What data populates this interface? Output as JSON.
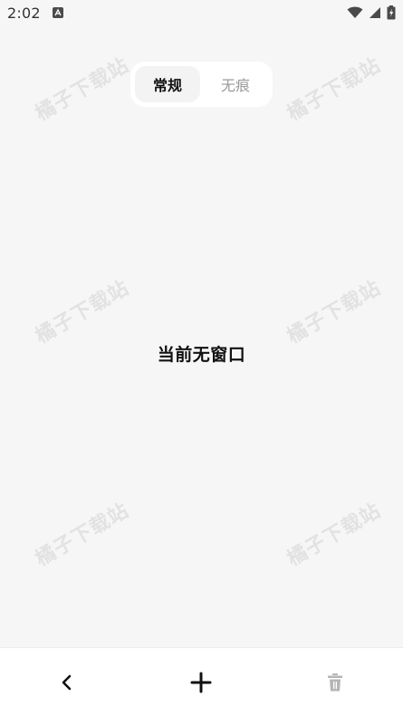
{
  "status_bar": {
    "time": "2:02",
    "icons": [
      "app-notification-icon",
      "wifi-icon",
      "cellular-signal-icon",
      "battery-charging-icon"
    ]
  },
  "tabs": {
    "items": [
      {
        "label": "常规",
        "selected": true
      },
      {
        "label": "无痕",
        "selected": false
      }
    ]
  },
  "main": {
    "empty_message": "当前无窗口"
  },
  "watermark": {
    "text": "橘子下载站"
  },
  "toolbar": {
    "back_icon": "chevron-left-icon",
    "add_icon": "plus-icon",
    "delete_icon": "trash-icon",
    "delete_enabled": false
  },
  "colors": {
    "background": "#f6f6f6",
    "surface": "#ffffff",
    "text_primary": "#111111",
    "text_muted": "#9a9a9a",
    "icon_disabled": "#b5b5b5"
  }
}
